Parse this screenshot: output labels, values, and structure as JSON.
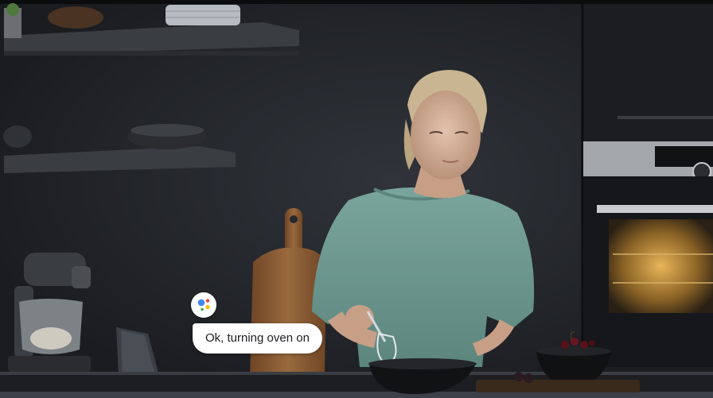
{
  "assistant": {
    "icon": "google-assistant-icon",
    "colors": {
      "blue": "#4285F4",
      "red": "#EA4335",
      "yellow": "#FBBC05",
      "green": "#34A853"
    },
    "response_text": "Ok, turning oven on"
  },
  "scene_colors": {
    "wall": "#24272c",
    "cabinet": "#1b1d21",
    "shirt": "#6f9a92",
    "cutting_board": "#8a5a32",
    "oven_frame": "#9a9ea3",
    "oven_glow": "#d9a441"
  }
}
